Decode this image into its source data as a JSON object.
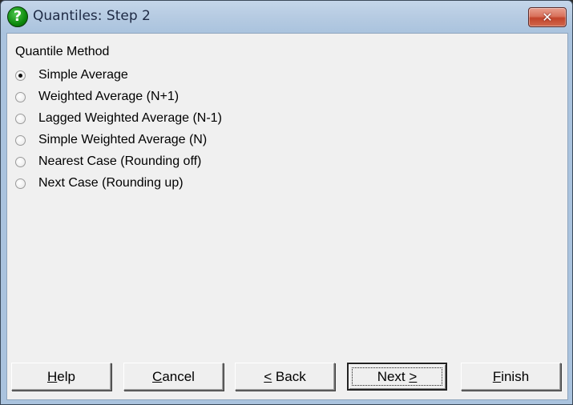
{
  "window": {
    "title": "Quantiles: Step 2",
    "app_icon": "help-question-icon",
    "close_glyph": "✕"
  },
  "group": {
    "label": "Quantile Method",
    "options": [
      {
        "label": "Simple Average",
        "checked": true
      },
      {
        "label": "Weighted Average (N+1)",
        "checked": false
      },
      {
        "label": "Lagged Weighted Average (N-1)",
        "checked": false
      },
      {
        "label": "Simple Weighted Average (N)",
        "checked": false
      },
      {
        "label": "Nearest Case (Rounding off)",
        "checked": false
      },
      {
        "label": "Next Case (Rounding up)",
        "checked": false
      }
    ]
  },
  "buttons": {
    "help": {
      "mnemonic": "H",
      "rest": "elp"
    },
    "cancel": {
      "mnemonic": "C",
      "rest": "ancel"
    },
    "back": {
      "mnemonic": "<",
      "rest": " Back"
    },
    "next": {
      "pre": "Next ",
      "mnemonic": ">",
      "default": true
    },
    "finish": {
      "mnemonic": "F",
      "rest": "inish"
    }
  }
}
